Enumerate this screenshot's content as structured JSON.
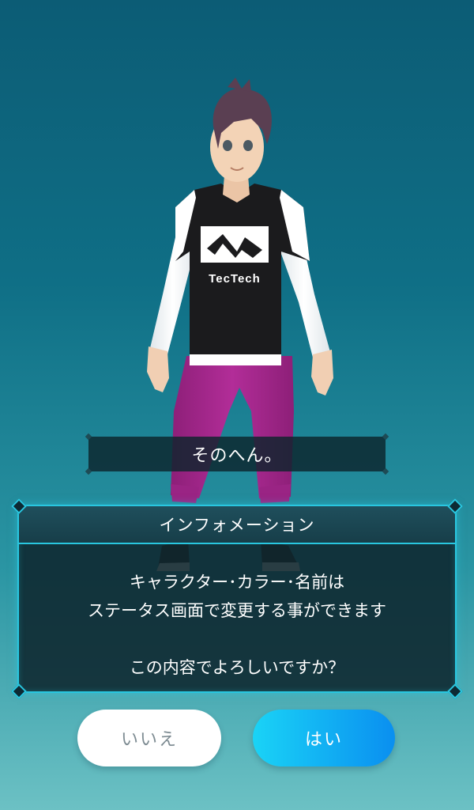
{
  "character": {
    "shirt_logo_text": "TecTech",
    "colors": {
      "hair": "#5a3f52",
      "skin": "#f3d3b6",
      "shirt": "#1b1b1d",
      "sleeves": "#ffffff",
      "pants": "#a1278a",
      "shoes": "#3a2a22"
    }
  },
  "name_plate": {
    "name": "そのへん。"
  },
  "info_dialog": {
    "title": "インフォメーション",
    "message_line1": "キャラクター･カラー･名前は",
    "message_line2": "ステータス画面で変更する事ができます",
    "question": "この内容でよろしいですか？",
    "border_color": "#29c7e0"
  },
  "buttons": {
    "no_label": "いいえ",
    "yes_label": "はい",
    "yes_color": "#0a8ff0"
  }
}
